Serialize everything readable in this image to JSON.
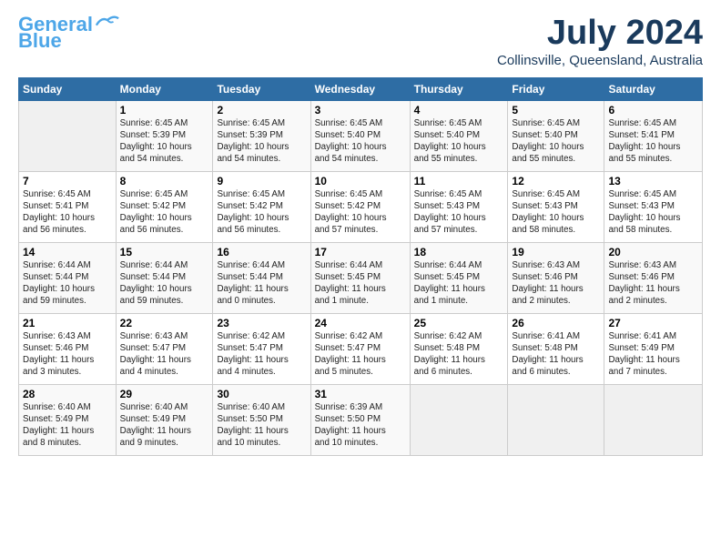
{
  "logo": {
    "line1": "General",
    "line2": "Blue"
  },
  "title": "July 2024",
  "location": "Collinsville, Queensland, Australia",
  "weekdays": [
    "Sunday",
    "Monday",
    "Tuesday",
    "Wednesday",
    "Thursday",
    "Friday",
    "Saturday"
  ],
  "weeks": [
    [
      {
        "day": "",
        "info": ""
      },
      {
        "day": "1",
        "info": "Sunrise: 6:45 AM\nSunset: 5:39 PM\nDaylight: 10 hours\nand 54 minutes."
      },
      {
        "day": "2",
        "info": "Sunrise: 6:45 AM\nSunset: 5:39 PM\nDaylight: 10 hours\nand 54 minutes."
      },
      {
        "day": "3",
        "info": "Sunrise: 6:45 AM\nSunset: 5:40 PM\nDaylight: 10 hours\nand 54 minutes."
      },
      {
        "day": "4",
        "info": "Sunrise: 6:45 AM\nSunset: 5:40 PM\nDaylight: 10 hours\nand 55 minutes."
      },
      {
        "day": "5",
        "info": "Sunrise: 6:45 AM\nSunset: 5:40 PM\nDaylight: 10 hours\nand 55 minutes."
      },
      {
        "day": "6",
        "info": "Sunrise: 6:45 AM\nSunset: 5:41 PM\nDaylight: 10 hours\nand 55 minutes."
      }
    ],
    [
      {
        "day": "7",
        "info": "Sunrise: 6:45 AM\nSunset: 5:41 PM\nDaylight: 10 hours\nand 56 minutes."
      },
      {
        "day": "8",
        "info": "Sunrise: 6:45 AM\nSunset: 5:42 PM\nDaylight: 10 hours\nand 56 minutes."
      },
      {
        "day": "9",
        "info": "Sunrise: 6:45 AM\nSunset: 5:42 PM\nDaylight: 10 hours\nand 56 minutes."
      },
      {
        "day": "10",
        "info": "Sunrise: 6:45 AM\nSunset: 5:42 PM\nDaylight: 10 hours\nand 57 minutes."
      },
      {
        "day": "11",
        "info": "Sunrise: 6:45 AM\nSunset: 5:43 PM\nDaylight: 10 hours\nand 57 minutes."
      },
      {
        "day": "12",
        "info": "Sunrise: 6:45 AM\nSunset: 5:43 PM\nDaylight: 10 hours\nand 58 minutes."
      },
      {
        "day": "13",
        "info": "Sunrise: 6:45 AM\nSunset: 5:43 PM\nDaylight: 10 hours\nand 58 minutes."
      }
    ],
    [
      {
        "day": "14",
        "info": "Sunrise: 6:44 AM\nSunset: 5:44 PM\nDaylight: 10 hours\nand 59 minutes."
      },
      {
        "day": "15",
        "info": "Sunrise: 6:44 AM\nSunset: 5:44 PM\nDaylight: 10 hours\nand 59 minutes."
      },
      {
        "day": "16",
        "info": "Sunrise: 6:44 AM\nSunset: 5:44 PM\nDaylight: 11 hours\nand 0 minutes."
      },
      {
        "day": "17",
        "info": "Sunrise: 6:44 AM\nSunset: 5:45 PM\nDaylight: 11 hours\nand 1 minute."
      },
      {
        "day": "18",
        "info": "Sunrise: 6:44 AM\nSunset: 5:45 PM\nDaylight: 11 hours\nand 1 minute."
      },
      {
        "day": "19",
        "info": "Sunrise: 6:43 AM\nSunset: 5:46 PM\nDaylight: 11 hours\nand 2 minutes."
      },
      {
        "day": "20",
        "info": "Sunrise: 6:43 AM\nSunset: 5:46 PM\nDaylight: 11 hours\nand 2 minutes."
      }
    ],
    [
      {
        "day": "21",
        "info": "Sunrise: 6:43 AM\nSunset: 5:46 PM\nDaylight: 11 hours\nand 3 minutes."
      },
      {
        "day": "22",
        "info": "Sunrise: 6:43 AM\nSunset: 5:47 PM\nDaylight: 11 hours\nand 4 minutes."
      },
      {
        "day": "23",
        "info": "Sunrise: 6:42 AM\nSunset: 5:47 PM\nDaylight: 11 hours\nand 4 minutes."
      },
      {
        "day": "24",
        "info": "Sunrise: 6:42 AM\nSunset: 5:47 PM\nDaylight: 11 hours\nand 5 minutes."
      },
      {
        "day": "25",
        "info": "Sunrise: 6:42 AM\nSunset: 5:48 PM\nDaylight: 11 hours\nand 6 minutes."
      },
      {
        "day": "26",
        "info": "Sunrise: 6:41 AM\nSunset: 5:48 PM\nDaylight: 11 hours\nand 6 minutes."
      },
      {
        "day": "27",
        "info": "Sunrise: 6:41 AM\nSunset: 5:49 PM\nDaylight: 11 hours\nand 7 minutes."
      }
    ],
    [
      {
        "day": "28",
        "info": "Sunrise: 6:40 AM\nSunset: 5:49 PM\nDaylight: 11 hours\nand 8 minutes."
      },
      {
        "day": "29",
        "info": "Sunrise: 6:40 AM\nSunset: 5:49 PM\nDaylight: 11 hours\nand 9 minutes."
      },
      {
        "day": "30",
        "info": "Sunrise: 6:40 AM\nSunset: 5:50 PM\nDaylight: 11 hours\nand 10 minutes."
      },
      {
        "day": "31",
        "info": "Sunrise: 6:39 AM\nSunset: 5:50 PM\nDaylight: 11 hours\nand 10 minutes."
      },
      {
        "day": "",
        "info": ""
      },
      {
        "day": "",
        "info": ""
      },
      {
        "day": "",
        "info": ""
      }
    ]
  ]
}
